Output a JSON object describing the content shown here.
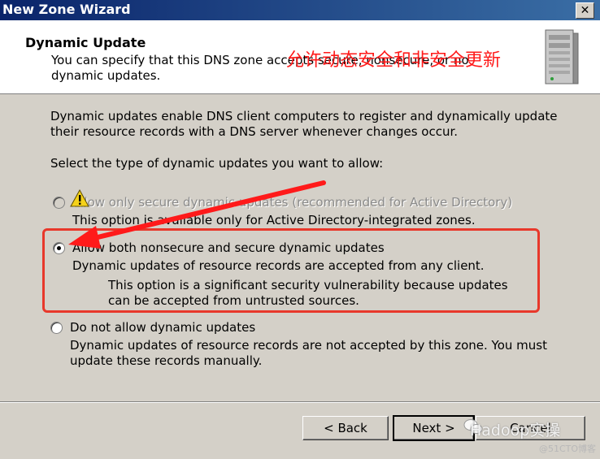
{
  "window": {
    "title": "New Zone Wizard",
    "close_glyph": "✕"
  },
  "header": {
    "title": "Dynamic Update",
    "description": "You can specify that this DNS zone accepts secure, nonsecure, or no dynamic updates."
  },
  "body": {
    "intro": "Dynamic updates enable DNS client computers to register and dynamically update their resource records with a DNS server whenever changes occur.",
    "select_prompt": "Select the type of dynamic updates you want to allow:",
    "annotation": "允许动态安全和非安全更新",
    "options": [
      {
        "label": "Allow only secure dynamic updates (recommended for Active Directory)",
        "description": "This option is available only for Active Directory-integrated zones.",
        "selected": false,
        "enabled": false
      },
      {
        "label": "Allow both nonsecure and secure dynamic updates",
        "description": "Dynamic updates of resource records are accepted from any client.",
        "warning": "This option is a significant security vulnerability because updates can be accepted from untrusted sources.",
        "selected": true,
        "enabled": true
      },
      {
        "label": "Do not allow dynamic updates",
        "description": "Dynamic updates of resource records are not accepted by this zone. You must update these records manually.",
        "selected": false,
        "enabled": true
      }
    ]
  },
  "buttons": {
    "back": "< Back",
    "next": "Next >",
    "cancel": "Cancel"
  },
  "watermark": {
    "text": "Hadoop实操",
    "small": "@51CTO博客"
  },
  "colors": {
    "annotation": "#ff1a1a",
    "highlight_box": "#e8382b",
    "title_bar": "#0a246a"
  }
}
